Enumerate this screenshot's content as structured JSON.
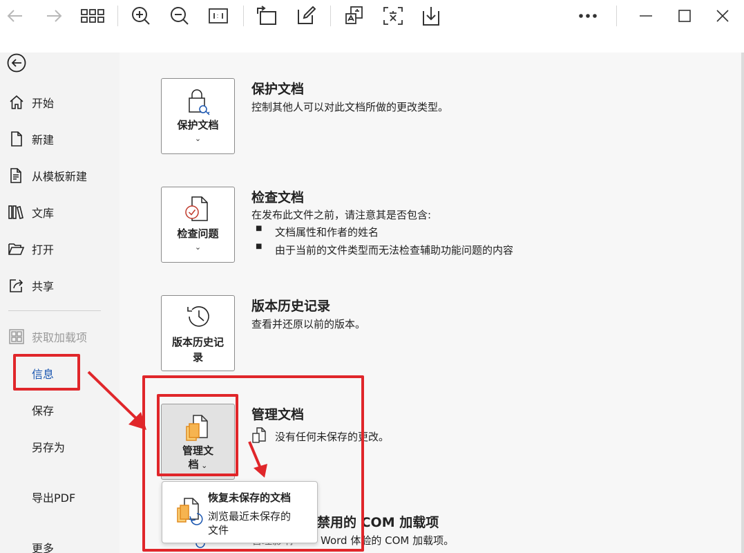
{
  "toolbar": {
    "icons": [
      "back-arrow-icon",
      "forward-arrow-icon",
      "grid-view-icon",
      "zoom-in-icon",
      "zoom-out-icon",
      "fit-width-icon",
      "rotate-icon",
      "edit-icon",
      "translate-icon",
      "text-recognition-icon",
      "download-icon",
      "more-icon",
      "minimize-icon",
      "maximize-icon",
      "close-icon"
    ]
  },
  "sidebar": {
    "items": [
      {
        "label": "开始"
      },
      {
        "label": "新建"
      },
      {
        "label": "从模板新建"
      },
      {
        "label": "文库"
      },
      {
        "label": "打开"
      },
      {
        "label": "共享"
      },
      {
        "label": "获取加载项"
      },
      {
        "label": "信息"
      },
      {
        "label": "保存"
      },
      {
        "label": "另存为"
      },
      {
        "label": "导出PDF"
      },
      {
        "label": "更多"
      }
    ]
  },
  "sections": {
    "protect": {
      "button_label": "保护文档",
      "title": "保护文档",
      "desc": "控制其他人可以对此文档所做的更改类型。"
    },
    "inspect": {
      "button_label": "检查问题",
      "title": "检查文档",
      "desc": "在发布此文件之前，请注意其是否包含:",
      "bullets": [
        "文档属性和作者的姓名",
        "由于当前的文件类型而无法检查辅助功能问题的内容"
      ]
    },
    "history": {
      "button_label_line1": "版本历史记",
      "button_label_line2": "录",
      "title": "版本历史记录",
      "desc": "查看并还原以前的版本。"
    },
    "manage": {
      "button_label_line1": "管理文",
      "button_label_line2": "档",
      "title": "管理文档",
      "desc": "没有任何未保存的更改。"
    },
    "com": {
      "title_partial": "禁用的 COM 加载项",
      "desc_partial": "Word 体验的 COM 加载项。"
    }
  },
  "popup": {
    "title": "恢复未保存的文档",
    "desc_line1": "浏览最近未保存的",
    "desc_line2": "文件"
  },
  "colors": {
    "highlight_red": "#e0262a",
    "accent_blue": "#1a56b0",
    "doc_orange": "#f0a030"
  }
}
